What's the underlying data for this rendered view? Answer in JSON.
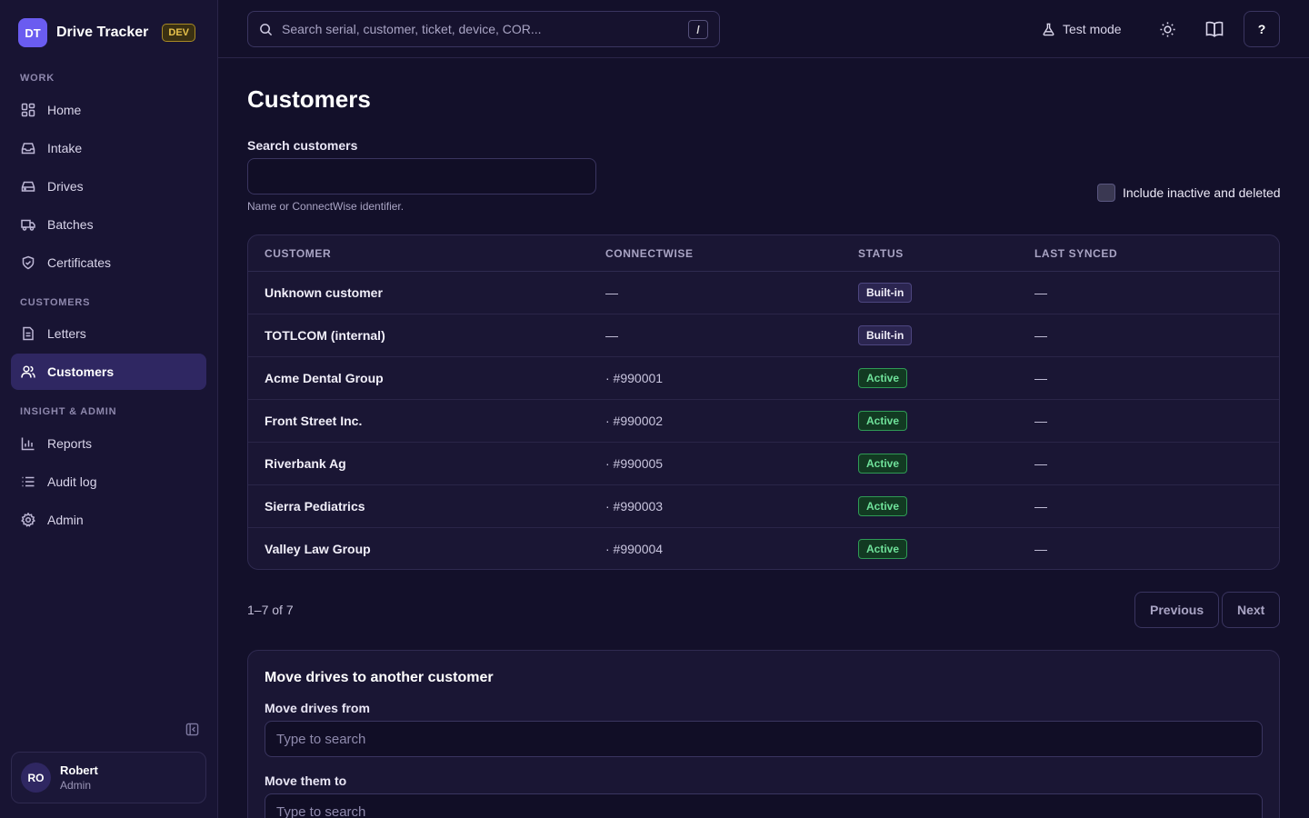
{
  "brand": {
    "logo": "DT",
    "name": "Drive Tracker",
    "env_badge": "DEV"
  },
  "sidebar": {
    "sections": [
      {
        "label": "WORK"
      },
      {
        "label": "CUSTOMERS"
      },
      {
        "label": "INSIGHT & ADMIN"
      }
    ],
    "items": [
      {
        "label": "Home",
        "icon": "grid-icon"
      },
      {
        "label": "Intake",
        "icon": "inbox-icon"
      },
      {
        "label": "Drives",
        "icon": "hard-drive-icon"
      },
      {
        "label": "Batches",
        "icon": "truck-icon"
      },
      {
        "label": "Certificates",
        "icon": "shield-check-icon"
      },
      {
        "label": "Letters",
        "icon": "document-icon"
      },
      {
        "label": "Customers",
        "icon": "users-icon",
        "active": true
      },
      {
        "label": "Reports",
        "icon": "bar-chart-icon"
      },
      {
        "label": "Audit log",
        "icon": "list-icon"
      },
      {
        "label": "Admin",
        "icon": "gear-icon"
      }
    ],
    "user": {
      "initials": "RO",
      "name": "Robert",
      "role": "Admin"
    }
  },
  "topbar": {
    "search_placeholder": "Search serial, customer, ticket, device, COR...",
    "search_shortcut": "/",
    "test_mode_label": "Test mode",
    "help_label": "?"
  },
  "page": {
    "title": "Customers",
    "search_label": "Search customers",
    "search_value": "",
    "search_help": "Name or ConnectWise identifier.",
    "include_inactive_label": "Include inactive and deleted",
    "include_inactive_checked": false
  },
  "table": {
    "headers": [
      "CUSTOMER",
      "CONNECTWISE",
      "STATUS",
      "LAST SYNCED"
    ],
    "rows": [
      {
        "customer": "Unknown customer",
        "connectwise": "—",
        "status": "Built-in",
        "status_kind": "builtin",
        "last_synced": "—"
      },
      {
        "customer": "TOTLCOM (internal)",
        "connectwise": "—",
        "status": "Built-in",
        "status_kind": "builtin",
        "last_synced": "—"
      },
      {
        "customer": "Acme Dental Group",
        "connectwise": "· #990001",
        "status": "Active",
        "status_kind": "active",
        "last_synced": "—"
      },
      {
        "customer": "Front Street Inc.",
        "connectwise": "· #990002",
        "status": "Active",
        "status_kind": "active",
        "last_synced": "—"
      },
      {
        "customer": "Riverbank Ag",
        "connectwise": "· #990005",
        "status": "Active",
        "status_kind": "active",
        "last_synced": "—"
      },
      {
        "customer": "Sierra Pediatrics",
        "connectwise": "· #990003",
        "status": "Active",
        "status_kind": "active",
        "last_synced": "—"
      },
      {
        "customer": "Valley Law Group",
        "connectwise": "· #990004",
        "status": "Active",
        "status_kind": "active",
        "last_synced": "—"
      }
    ]
  },
  "pagination": {
    "summary": "1–7 of 7",
    "previous_label": "Previous",
    "next_label": "Next"
  },
  "move": {
    "title": "Move drives to another customer",
    "from_label": "Move drives from",
    "from_placeholder": "Type to search",
    "to_label": "Move them to",
    "to_placeholder": "Type to search"
  },
  "colors": {
    "accent": "#6a5cf0",
    "active_nav": "#2f2762",
    "active_green": "#6fe19a",
    "dev_badge": "#e8c24c"
  }
}
